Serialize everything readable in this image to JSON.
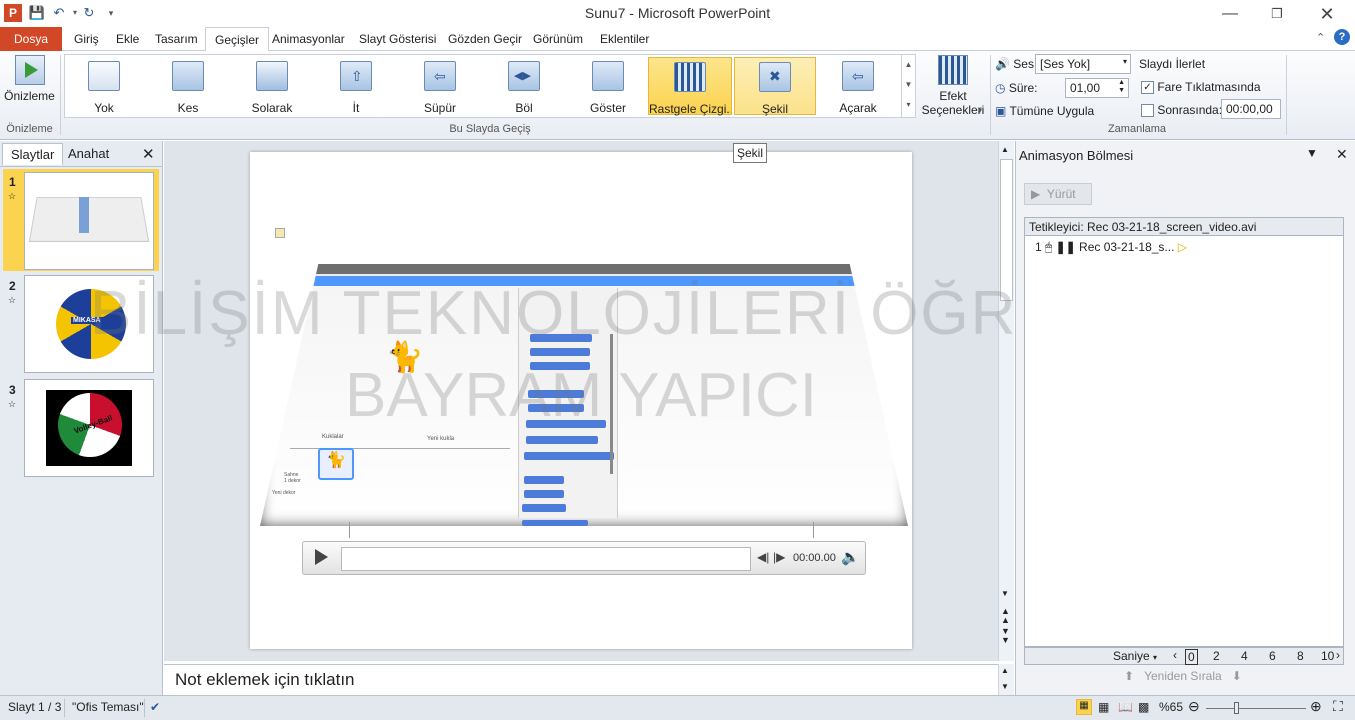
{
  "app": {
    "title": "Sunu7  -  Microsoft PowerPoint"
  },
  "tabs": [
    {
      "label": "Dosya"
    },
    {
      "label": "Giriş"
    },
    {
      "label": "Ekle"
    },
    {
      "label": "Tasarım"
    },
    {
      "label": "Geçişler"
    },
    {
      "label": "Animasyonlar"
    },
    {
      "label": "Slayt Gösterisi"
    },
    {
      "label": "Gözden Geçir"
    },
    {
      "label": "Görünüm"
    },
    {
      "label": "Eklentiler"
    }
  ],
  "ribbon": {
    "preview_label": "Önizleme",
    "preview_group": "Önizleme",
    "transitions": [
      "Yok",
      "Kes",
      "Solarak",
      "İt",
      "Süpür",
      "Böl",
      "Göster",
      "Rastgele Çizgi...",
      "Şekil",
      "Açarak"
    ],
    "transitions_group": "Bu Slayda Geçiş",
    "effect_options": "Efekt\nSeçenekleri",
    "sound_label": "Ses:",
    "sound_value": "[Ses Yok]",
    "duration_label": "Süre:",
    "duration_value": "01,00",
    "apply_all": "Tümüne Uygula",
    "advance_title": "Slaydı İlerlet",
    "on_click": "Fare Tıklatmasında",
    "after": "Sonrasında:",
    "after_value": "00:00,00",
    "timing_group": "Zamanlama",
    "tooltip": "Şekil"
  },
  "leftpane": {
    "tab_slides": "Slaytlar",
    "tab_outline": "Anahat",
    "slides": [
      "1",
      "2",
      "3"
    ],
    "volley_text": "Volley-Ball",
    "mikasa": "MIKASA"
  },
  "slide": {
    "watermark1": "BİLİŞİM TEKNOLOJİLERİ ÖĞRETMENİ",
    "watermark2": "BAYRAM YAPICI",
    "player_time": "00:00.00",
    "sprites_label": "Kuklalar",
    "new_sprite": "Yeni kukla",
    "stage_label": "Sahne\n1 dekor",
    "new_backdrop": "Yeni dekor"
  },
  "notes": {
    "placeholder": "Not eklemek için tıklatın"
  },
  "animpane": {
    "title": "Animasyon Bölmesi",
    "play": "Yürüt",
    "trigger": "Tetikleyici: Rec 03-21-18_screen_video.avi",
    "item_num": "1",
    "item_name": "Rec 03-21-18_s...",
    "seconds": "Saniye",
    "ticks": [
      "0",
      "2",
      "4",
      "6",
      "8",
      "10"
    ],
    "reorder": "Yeniden Sırala"
  },
  "status": {
    "slide": "Slayt 1 / 3",
    "theme": "\"Ofis Teması\"",
    "zoom": "%65"
  }
}
